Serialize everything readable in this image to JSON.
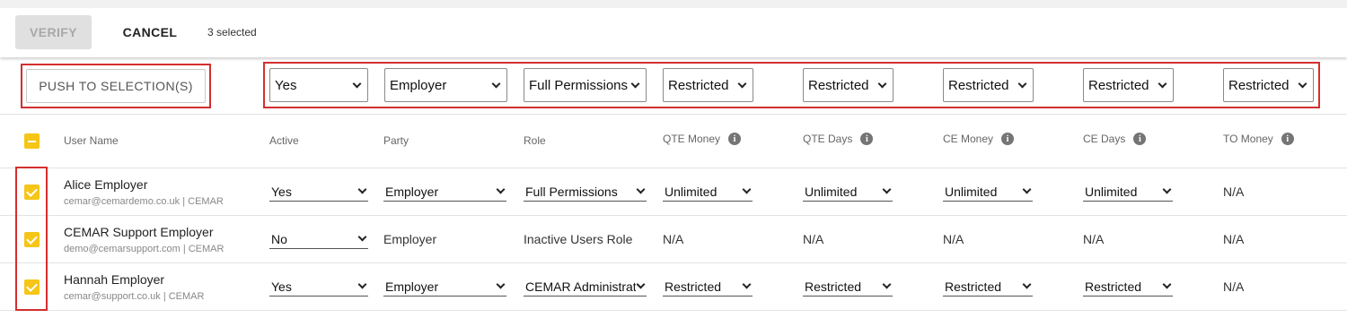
{
  "toolbar": {
    "verify_label": "VERIFY",
    "cancel_label": "CANCEL",
    "selected_text": "3 selected"
  },
  "push": {
    "button_label": "PUSH TO SELECTION(S)",
    "selects": [
      "Yes",
      "Employer",
      "Full Permissions",
      "Restricted",
      "Restricted",
      "Restricted",
      "Restricted",
      "Restricted"
    ]
  },
  "columns": {
    "user_name": "User Name",
    "active": "Active",
    "party": "Party",
    "role": "Role",
    "qte_money": "QTE Money",
    "qte_days": "QTE Days",
    "ce_money": "CE Money",
    "ce_days": "CE Days",
    "to_money": "TO Money"
  },
  "info_icon_glyph": "i",
  "rows": [
    {
      "name": "Alice Employer",
      "email": "cemar@cemardemo.co.uk | CEMAR",
      "active": "Yes",
      "party": "Employer",
      "role": "Full Permissions",
      "qte_money": "Unlimited",
      "qte_days": "Unlimited",
      "ce_money": "Unlimited",
      "ce_days": "Unlimited",
      "to_money": "N/A"
    },
    {
      "name": "CEMAR Support Employer",
      "email": "demo@cemarsupport.com | CEMAR",
      "active": "No",
      "party": "Employer",
      "role": "Inactive Users Role",
      "qte_money": "N/A",
      "qte_days": "N/A",
      "ce_money": "N/A",
      "ce_days": "N/A",
      "to_money": "N/A"
    },
    {
      "name": "Hannah Employer",
      "email": "cemar@support.co.uk | CEMAR",
      "active": "Yes",
      "party": "Employer",
      "role": "CEMAR Administrator",
      "qte_money": "Restricted",
      "qte_days": "Restricted",
      "ce_money": "Restricted",
      "ce_days": "Restricted",
      "to_money": "N/A"
    }
  ],
  "colors": {
    "accent_yellow": "#f5c518",
    "highlight_red": "#d32f2f"
  }
}
